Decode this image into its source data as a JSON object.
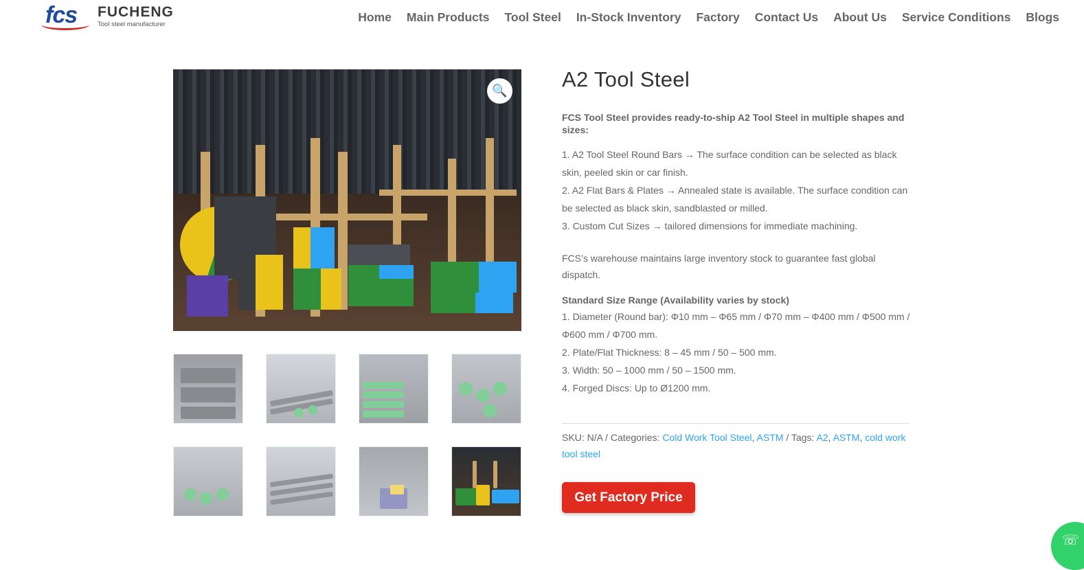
{
  "header": {
    "logo_letters": "fcs",
    "logo_name": "FUCHENG",
    "logo_tagline": "Tool steel manufacturer",
    "nav": [
      "Home",
      "Main Products",
      "Tool Steel",
      "In-Stock Inventory",
      "Factory",
      "Contact Us",
      "About Us",
      "Service Conditions",
      "Blogs"
    ]
  },
  "product": {
    "title": "A2 Tool Steel",
    "intro": "FCS Tool Steel provides ready-to-ship A2 Tool Steel in multiple shapes and sizes:",
    "features": [
      "1. A2 Tool Steel Round Bars → The surface condition can be selected as black skin, peeled skin or car finish.",
      "2. A2 Flat Bars & Plates → Annealed state is available. The surface condition can be selected as black skin, sandblasted or milled.",
      "3. Custom Cut Sizes → tailored dimensions for immediate machining."
    ],
    "warehouse_note": "FCS’s warehouse maintains large inventory stock to guarantee fast global dispatch.",
    "size_title": "Standard Size Range (Availability varies by stock)",
    "sizes": [
      "1. Diameter (Round bar): Φ10 mm – Φ65 mm / Φ70 mm – Φ400 mm / Φ500 mm / Φ600 mm / Φ700 mm.",
      "2. Plate/Flat Thickness: 8 – 45 mm / 50 – 500 mm.",
      "3. Width: 50 – 1000 mm / 50 – 1500 mm.",
      "4. Forged Discs: Up to Ø1200 mm."
    ],
    "meta": {
      "sku_label": "SKU:",
      "sku_value": "N/A",
      "sep1": "/",
      "categories_label": "Categories:",
      "categories": [
        "Cold Work Tool Steel",
        "ASTM"
      ],
      "sep2": "/",
      "tags_label": "Tags:",
      "tags": [
        "A2",
        "ASTM",
        "cold work tool steel"
      ],
      "comma": ","
    },
    "cta_label": "Get Factory Price"
  },
  "gallery": {
    "zoom_icon": "🔍"
  },
  "colors": {
    "accent": "#2ea3f2",
    "cta": "#e02b20",
    "text": "#666666",
    "title": "#333333"
  }
}
